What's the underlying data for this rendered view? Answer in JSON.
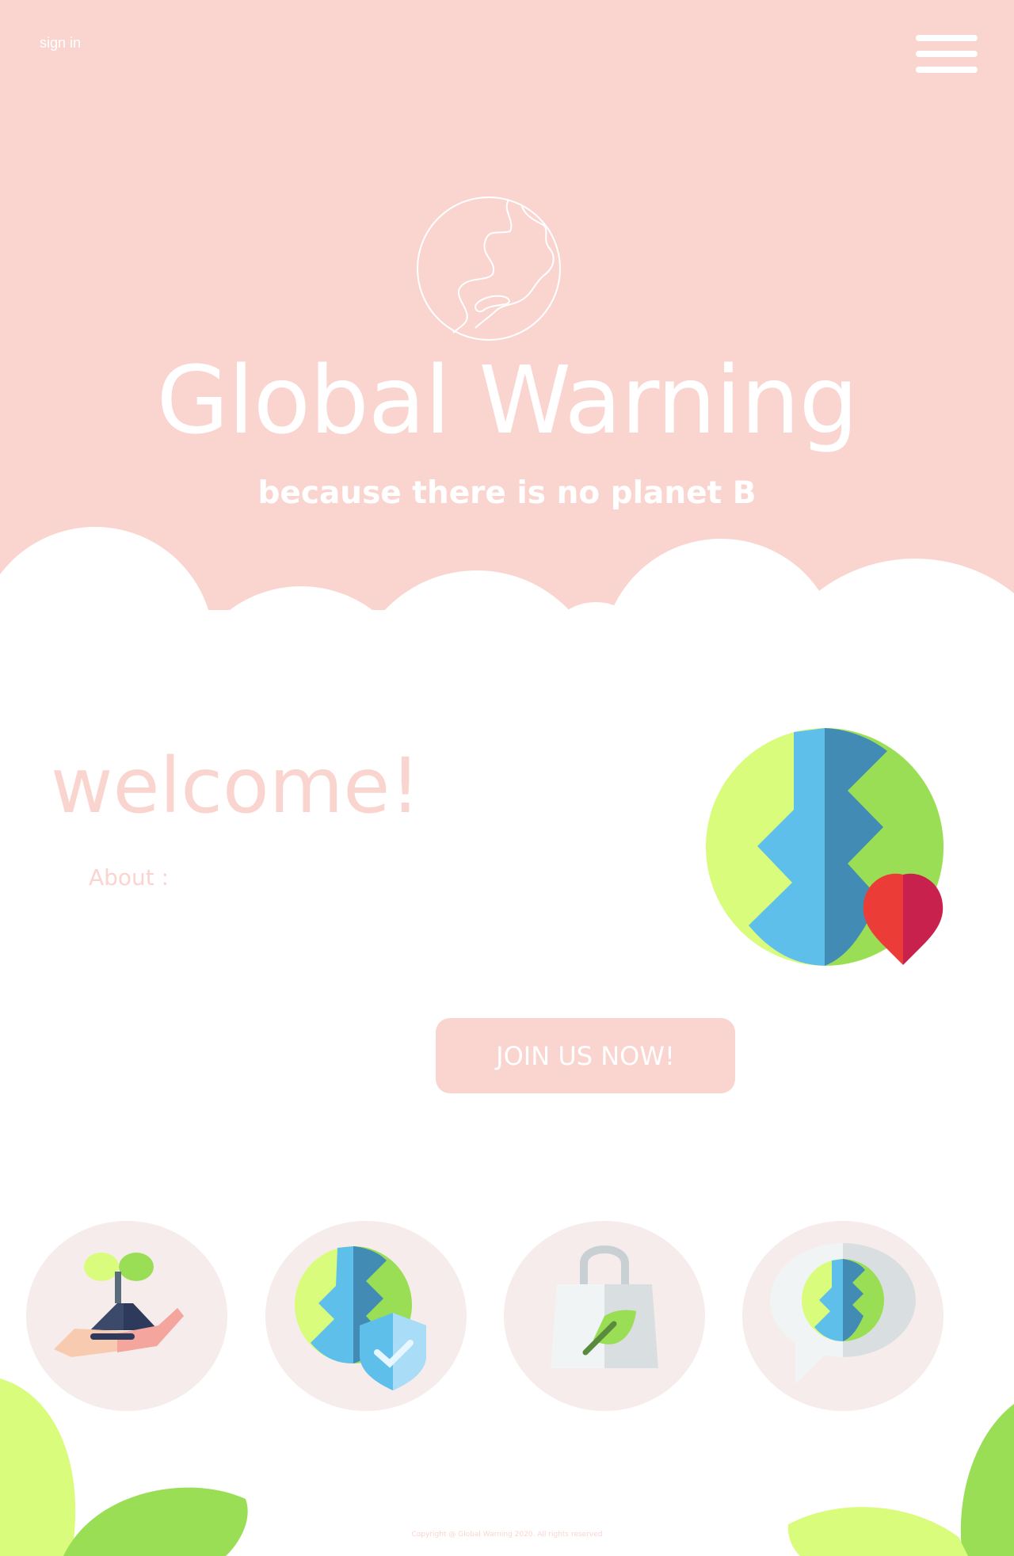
{
  "header": {
    "sign_in_label": "sign in",
    "menu_icon": "hamburger-menu-icon",
    "logo_icon": "globe-outline-icon",
    "title": "Global Warning",
    "tagline": "because there is no planet B"
  },
  "welcome": {
    "heading": "welcome!",
    "about_label": "About :",
    "illustration_icon": "earth-with-heart-icon",
    "cta_label": "JOIN US NOW!"
  },
  "features": [
    {
      "icon": "plant-in-hand-icon"
    },
    {
      "icon": "earth-with-shield-icon"
    },
    {
      "icon": "eco-shopping-bag-icon"
    },
    {
      "icon": "earth-speech-bubble-icon"
    }
  ],
  "footer": {
    "copyright": "Copyright @ Global Warning 2020. All rights reserved"
  },
  "colors": {
    "hero_pink": "#fad5d0",
    "text_white": "#ffffff",
    "feature_circle": "#f6eceb",
    "leaf_light": "#dafc7c",
    "leaf_green": "#9ade55",
    "earth_blue": "#5ec0ea",
    "earth_dark_blue": "#428bb5",
    "heart_red": "#ec3c37",
    "heart_crimson": "#c9214d"
  }
}
